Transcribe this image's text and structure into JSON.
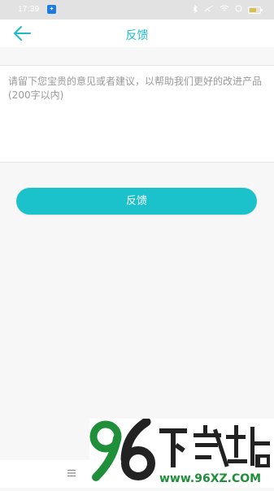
{
  "status_bar": {
    "time": "17:39",
    "app_icon": "app-icon"
  },
  "header": {
    "title": "反馈",
    "back_icon": "arrow-left-icon"
  },
  "feedback": {
    "placeholder": "请留下您宝贵的意见或者建议，以帮助我们更好的改进产品(200字以内)",
    "value": ""
  },
  "submit": {
    "label": "反馈"
  },
  "watermark": {
    "brand": "96下载站",
    "url": "www.96XZ.COM"
  },
  "colors": {
    "accent": "#1bc1cb",
    "title": "#1fbcc8",
    "watermark_green": "#1f8f3a"
  }
}
